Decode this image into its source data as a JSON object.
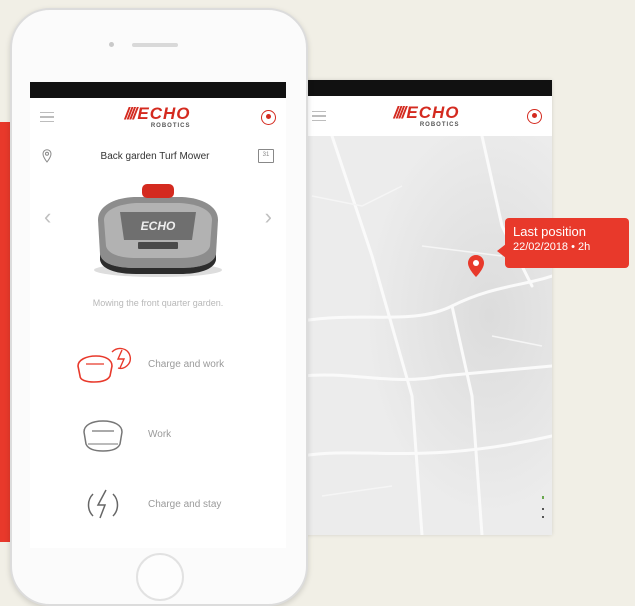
{
  "app": {
    "logo_text": "ECHO",
    "logo_sub": "ROBOTICS"
  },
  "main_screen": {
    "mower_name": "Back garden Turf Mower",
    "status_text": "Mowing the front quarter garden.",
    "actions": [
      {
        "label": "Charge and work",
        "icon": "mower-charge-icon"
      },
      {
        "label": "Work",
        "icon": "mower-icon"
      },
      {
        "label": "Charge and stay",
        "icon": "charge-icon"
      }
    ]
  },
  "map_screen": {
    "tooltip_title": "Last position",
    "tooltip_detail": "22/02/2018 • 2h"
  },
  "colors": {
    "brand_red": "#e8392b",
    "logo_red": "#d42a1f",
    "background": "#f1efe6"
  }
}
